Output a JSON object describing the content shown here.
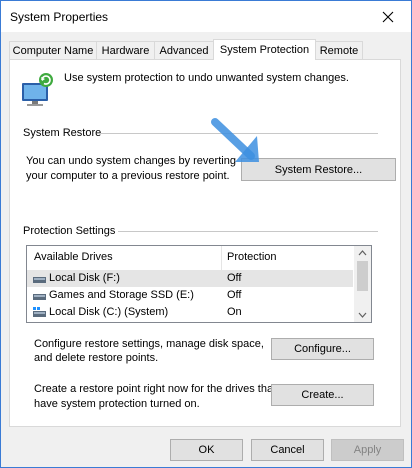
{
  "window": {
    "title": "System Properties"
  },
  "tabs": [
    {
      "label": "Computer Name",
      "active": false
    },
    {
      "label": "Hardware",
      "active": false
    },
    {
      "label": "Advanced",
      "active": false
    },
    {
      "label": "System Protection",
      "active": true
    },
    {
      "label": "Remote",
      "active": false
    }
  ],
  "intro": {
    "text": "Use system protection to undo unwanted system changes.",
    "icon": "system-protection-icon"
  },
  "system_restore": {
    "heading": "System Restore",
    "description_line1": "You can undo system changes by reverting",
    "description_line2": "your computer to a previous restore point.",
    "button_label": "System Restore...",
    "pointer_icon": "arrow-pointer-icon"
  },
  "protection": {
    "heading": "Protection Settings",
    "columns": [
      "Available Drives",
      "Protection"
    ],
    "drives": [
      {
        "name": "Local Disk (F:)",
        "protection": "Off",
        "icon": "drive-icon",
        "selected": true
      },
      {
        "name": "Games and Storage SSD (E:)",
        "protection": "Off",
        "icon": "drive-icon",
        "selected": false
      },
      {
        "name": "Local Disk (C:) (System)",
        "protection": "On",
        "icon": "system-drive-icon",
        "selected": false
      }
    ]
  },
  "configure": {
    "text_line1": "Configure restore settings, manage disk space,",
    "text_line2": "and delete restore points.",
    "button_label": "Configure..."
  },
  "create": {
    "text_line1": "Create a restore point right now for the drives that",
    "text_line2": "have system protection turned on.",
    "button_label": "Create..."
  },
  "footer": {
    "ok_label": "OK",
    "cancel_label": "Cancel",
    "apply_label": "Apply"
  },
  "colors": {
    "window_border": "#3a7bd5",
    "accent_arrow": "#3d8fe0",
    "selection": "#e5e5e5"
  }
}
